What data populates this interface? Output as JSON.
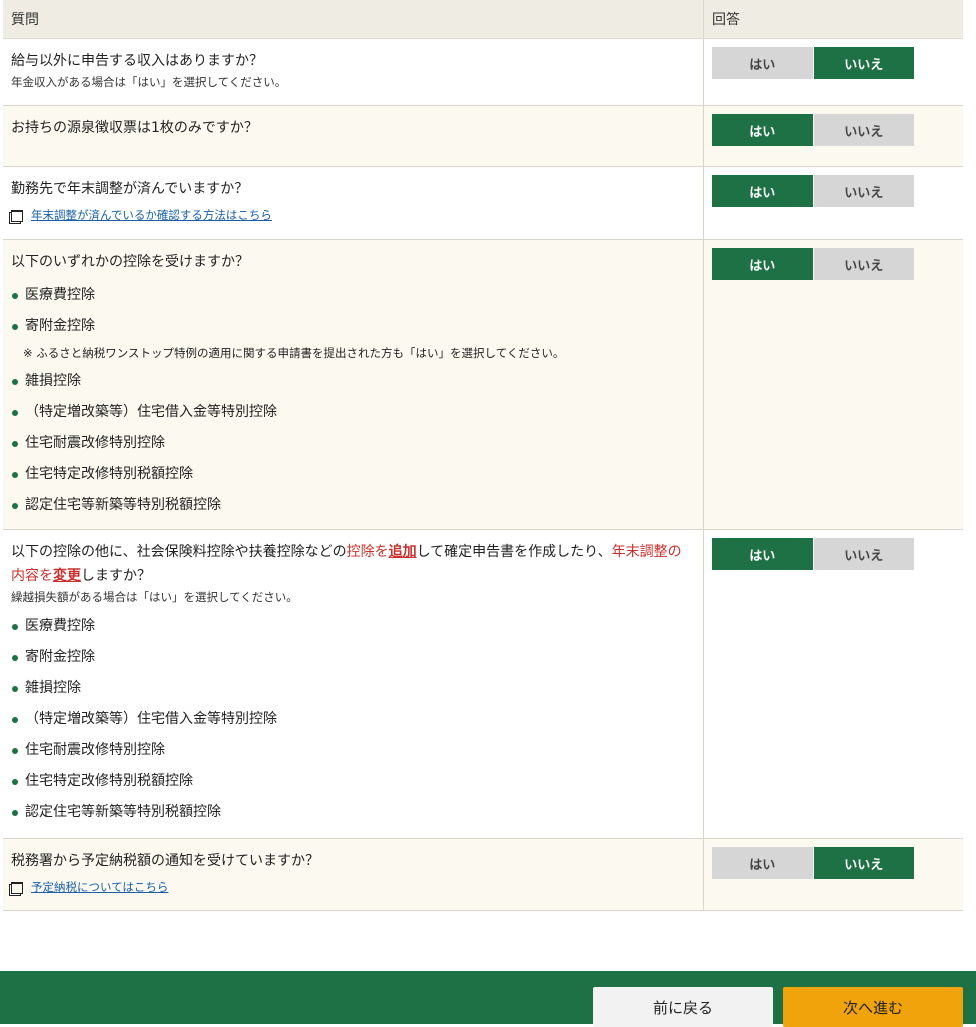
{
  "table": {
    "header_question": "質問",
    "header_answer": "回答"
  },
  "yes_label": "はい",
  "no_label": "いいえ",
  "rows": [
    {
      "question": "給与以外に申告する収入はありますか？",
      "note": "年金収入がある場合は「はい」を選択してください。",
      "answer": "no"
    },
    {
      "question": "お持ちの源泉徴収票は1枚のみですか？",
      "answer": "yes"
    },
    {
      "question": "勤務先で年末調整が済んでいますか？",
      "link": "年末調整が済んでいるか確認する方法はこちら",
      "answer": "yes"
    },
    {
      "question": "以下のいずれかの控除を受けますか？",
      "items": [
        "医療費控除",
        "寄附金控除",
        "雑損控除",
        "（特定増改築等）住宅借入金等特別控除",
        "住宅耐震改修特別控除",
        "住宅特定改修特別税額控除",
        "認定住宅等新築等特別税額控除"
      ],
      "subnote": "※ ふるさと納税ワンストップ特例の適用に関する申請書を提出された方も「はい」を選択してください。",
      "answer": "yes"
    },
    {
      "question_parts": {
        "p1": "以下の控除の他に、社会保険料控除や扶養控除などの",
        "p2": "控除を",
        "p3": "追加",
        "p4": "して確定申告書を作成したり、",
        "p5": "年末調整の内容を",
        "p6": "変更",
        "p7": "しますか？"
      },
      "note": "繰越損失額がある場合は「はい」を選択してください。",
      "items": [
        "医療費控除",
        "寄附金控除",
        "雑損控除",
        "（特定増改築等）住宅借入金等特別控除",
        "住宅耐震改修特別控除",
        "住宅特定改修特別税額控除",
        "認定住宅等新築等特別税額控除"
      ],
      "answer": "yes"
    },
    {
      "question": "税務署から予定納税額の通知を受けていますか？",
      "link": "予定納税についてはこちら",
      "answer": "no"
    }
  ],
  "footer": {
    "back_label": "前に戻る",
    "next_label": "次へ進む"
  },
  "colors": {
    "accent_green": "#1d7144",
    "next_orange": "#f0a30a",
    "emphasis_red": "#c9302c",
    "link_blue": "#1a5fa8"
  }
}
